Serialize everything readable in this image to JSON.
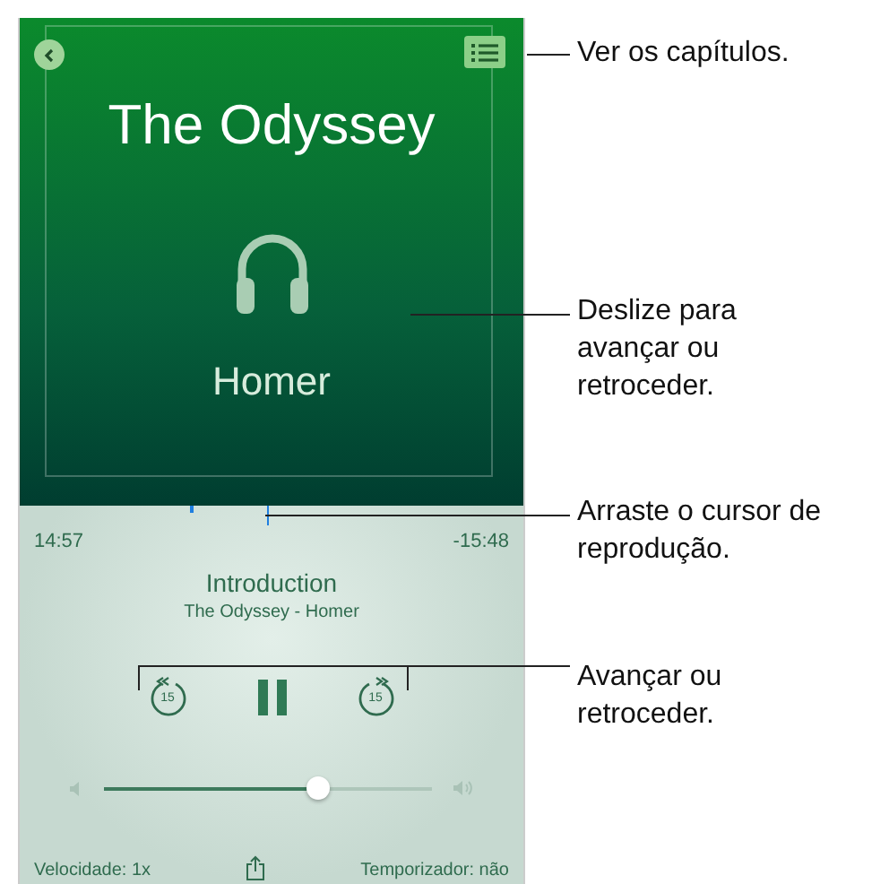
{
  "cover": {
    "title": "The Odyssey",
    "author": "Homer"
  },
  "scrubber": {
    "level": 0.486,
    "elapsed": "14:57",
    "remaining": "-15:48"
  },
  "now_playing": {
    "chapter": "Introduction",
    "subtitle": "The Odyssey - Homer"
  },
  "controls": {
    "skip_back": "15",
    "skip_forward": "15",
    "playing": true
  },
  "volume": {
    "level": 0.65
  },
  "footer": {
    "speed": "Velocidade: 1x",
    "timer": "Temporizador: não"
  },
  "callouts": [
    {
      "text": "Ver os capítulos."
    },
    {
      "text": "Deslize para avançar ou retroceder."
    },
    {
      "text": "Arraste o cursor de reprodução."
    },
    {
      "text": "Avançar ou retroceder."
    }
  ]
}
